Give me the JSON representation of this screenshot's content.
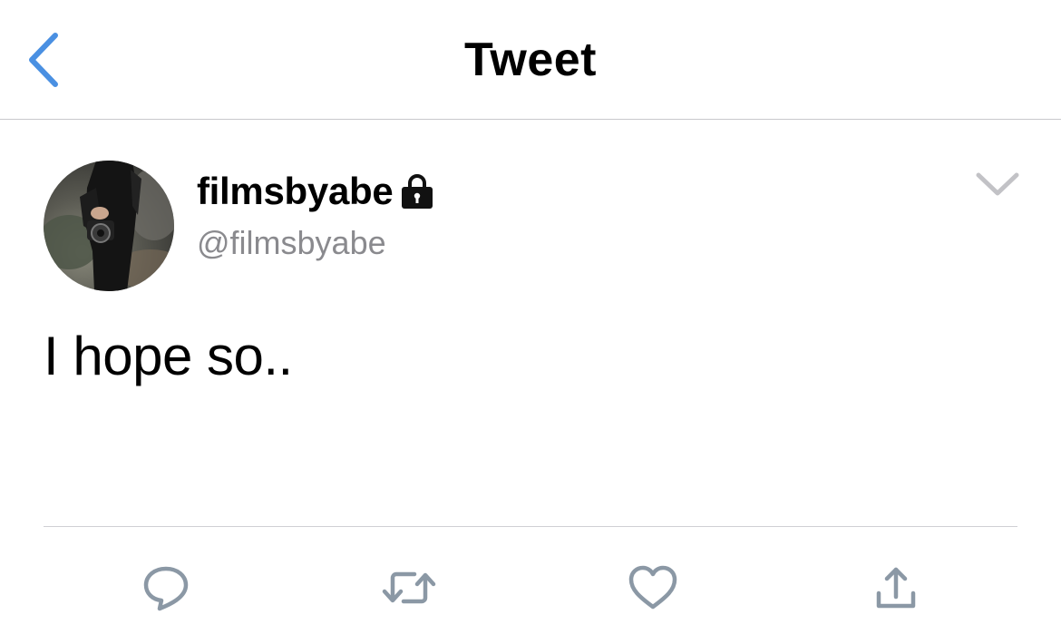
{
  "nav": {
    "title": "Tweet",
    "back_icon": "chevron-left-icon",
    "accent_color": "#4a90e2"
  },
  "tweet": {
    "display_name": "filmsbyabe",
    "handle": "@filmsbyabe",
    "protected_icon": "lock-icon",
    "text": "I hope so..",
    "menu_icon": "chevron-down-icon"
  },
  "actions": [
    {
      "name": "reply",
      "icon": "comment-icon"
    },
    {
      "name": "retweet",
      "icon": "retweet-icon"
    },
    {
      "name": "like",
      "icon": "heart-icon"
    },
    {
      "name": "share",
      "icon": "share-icon"
    }
  ],
  "colors": {
    "icon_gray": "#8b98a5",
    "handle_gray": "#8a8a8e",
    "divider": "#d0d0d4"
  }
}
